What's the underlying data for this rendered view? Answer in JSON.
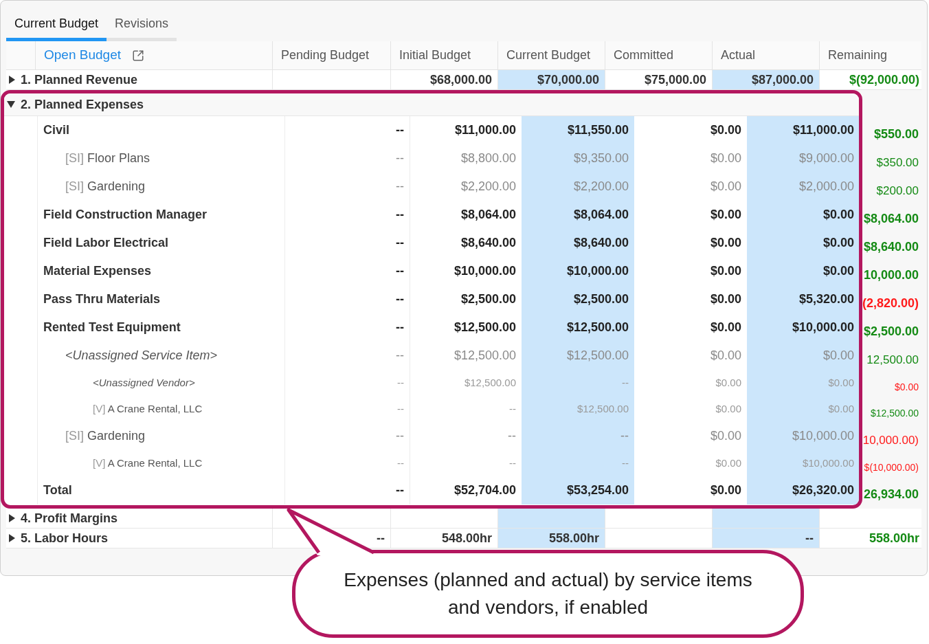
{
  "tabs": [
    {
      "label": "Current Budget",
      "selected": true
    },
    {
      "label": "Revisions",
      "selected": false
    }
  ],
  "open_budget_link": "Open Budget",
  "columns": [
    {
      "label": "Pending Budget",
      "highlight": false
    },
    {
      "label": "Initial Budget",
      "highlight": false
    },
    {
      "label": "Current Budget",
      "highlight": true
    },
    {
      "label": "Committed",
      "highlight": false
    },
    {
      "label": "Actual",
      "highlight": true
    },
    {
      "label": "Remaining",
      "highlight": false
    }
  ],
  "revenue_row": {
    "label": "1. Planned Revenue",
    "expanded": false,
    "cells": [
      null,
      "$68,000.00",
      "$70,000.00",
      "$75,000.00",
      "$87,000.00",
      "$(92,000.00)"
    ]
  },
  "expenses": {
    "label": "2. Planned Expenses",
    "expanded": true,
    "rows": [
      {
        "label": "Civil",
        "values": [
          "--",
          "$11,000.00",
          "$11,550.00",
          "$0.00",
          "$11,000.00"
        ],
        "remaining": {
          "text": "$550.00",
          "color": "#148a14"
        },
        "children": [
          {
            "prefix": "[SI]",
            "label": "Floor Plans",
            "values": [
              "--",
              "$8,800.00",
              "$9,350.00",
              "$0.00",
              "$9,000.00"
            ],
            "remaining": {
              "text": "$350.00",
              "color": "#148a14"
            }
          },
          {
            "prefix": "[SI]",
            "label": "Gardening",
            "values": [
              "--",
              "$2,200.00",
              "$2,200.00",
              "$0.00",
              "$2,000.00"
            ],
            "remaining": {
              "text": "$200.00",
              "color": "#148a14"
            }
          }
        ]
      },
      {
        "label": "Field Construction Manager",
        "values": [
          "--",
          "$8,064.00",
          "$8,064.00",
          "$0.00",
          "$0.00"
        ],
        "remaining": {
          "text": "$8,064.00",
          "color": "#148a14"
        }
      },
      {
        "label": "Field Labor Electrical",
        "values": [
          "--",
          "$8,640.00",
          "$8,640.00",
          "$0.00",
          "$0.00"
        ],
        "remaining": {
          "text": "$8,640.00",
          "color": "#148a14"
        }
      },
      {
        "label": "Material Expenses",
        "values": [
          "--",
          "$10,000.00",
          "$10,000.00",
          "$0.00",
          "$0.00"
        ],
        "remaining": {
          "text": "10,000.00",
          "color": "#148a14"
        }
      },
      {
        "label": "Pass Thru Materials",
        "values": [
          "--",
          "$2,500.00",
          "$2,500.00",
          "$0.00",
          "$5,320.00"
        ],
        "remaining": {
          "text": "(2,820.00)",
          "color": "#ff1a1a"
        }
      },
      {
        "label": "Rented Test Equipment",
        "values": [
          "--",
          "$12,500.00",
          "$12,500.00",
          "$0.00",
          "$10,000.00"
        ],
        "remaining": {
          "text": "$2,500.00",
          "color": "#148a14"
        },
        "children": [
          {
            "label": "<Unassigned Service Item>",
            "italic": true,
            "values": [
              "--",
              "$12,500.00",
              "$12,500.00",
              "$0.00",
              "$0.00"
            ],
            "remaining": {
              "text": "12,500.00",
              "color": "#148a14"
            },
            "children": [
              {
                "label": "<Unassigned Vendor>",
                "italic": true,
                "values": [
                  "--",
                  "$12,500.00",
                  "--",
                  "$0.00",
                  "$0.00"
                ],
                "remaining": {
                  "text": "$0.00",
                  "color": "#ff1a1a"
                }
              },
              {
                "prefix": "[V]",
                "label": "A Crane Rental, LLC",
                "italic": false,
                "values": [
                  "--",
                  "--",
                  "$12,500.00",
                  "$0.00",
                  "$0.00"
                ],
                "remaining": {
                  "text": "$12,500.00",
                  "color": "#148a14"
                }
              }
            ]
          },
          {
            "prefix": "[SI]",
            "label": "Gardening",
            "italic": false,
            "values": [
              "--",
              "--",
              "--",
              "$0.00",
              "$10,000.00"
            ],
            "remaining": {
              "text": "10,000.00)",
              "color": "#ff1a1a"
            },
            "children": [
              {
                "prefix": "[V]",
                "label": "A Crane Rental, LLC",
                "values": [
                  "--",
                  "--",
                  "--",
                  "$0.00",
                  "$10,000.00"
                ],
                "remaining": {
                  "text": "$(10,000.00)",
                  "color": "#ff1a1a"
                }
              }
            ]
          }
        ]
      }
    ],
    "total": {
      "label": "Total",
      "values": [
        "--",
        "$52,704.00",
        "$53,254.00",
        "$0.00",
        "$26,320.00"
      ],
      "remaining": {
        "text": "26,934.00",
        "color": "#148a14"
      }
    }
  },
  "bottom_rows": [
    {
      "label": "4. Profit Margins",
      "expanded": false,
      "cells": [
        null,
        null,
        null,
        null,
        null,
        null
      ]
    },
    {
      "label": "5. Labor Hours",
      "expanded": false,
      "cells": [
        "--",
        "548.00hr",
        "558.00hr",
        null,
        "--",
        "558.00hr"
      ]
    }
  ],
  "callout": {
    "text": "Expenses (planned and actual) by service items and vendors, if enabled"
  }
}
